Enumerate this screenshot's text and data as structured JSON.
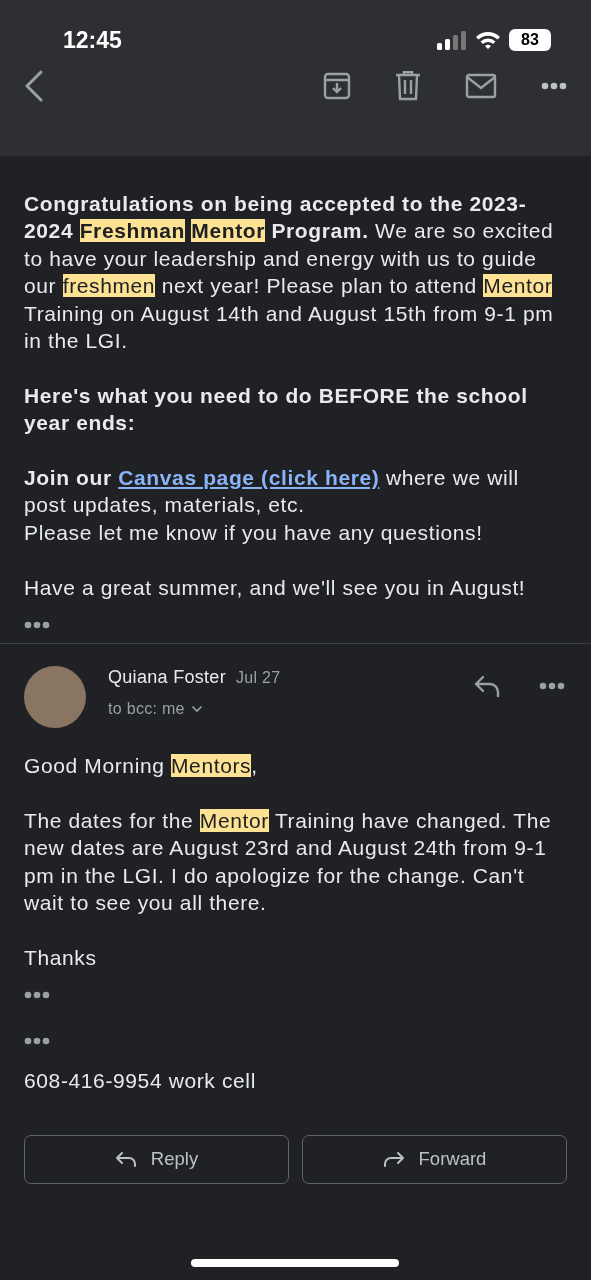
{
  "status_bar": {
    "time": "12:45",
    "battery": "83"
  },
  "messages": [
    {
      "blocks": [
        {
          "kind": "paragraph",
          "segments": [
            {
              "text": "Congratulations on being accepted to the 2023-2024 ",
              "bold": true,
              "highlighted": false
            },
            {
              "text": "Freshman",
              "bold": true,
              "highlighted": true
            },
            {
              "text": "Mentor",
              "bold": true,
              "highlighted": true
            },
            {
              "text": " Program.",
              "bold": true,
              "highlighted": false
            },
            {
              "text": " We are so excited to have your leadership and energy with us to guide our ",
              "bold": false,
              "highlighted": false
            },
            {
              "text": "freshmen",
              "bold": false,
              "highlighted": true
            },
            {
              "text": " next year! Please plan to attend ",
              "bold": false,
              "highlighted": false
            },
            {
              "text": "Mentor",
              "bold": false,
              "highlighted": true
            },
            {
              "text": " Training on August 14th and August 15th from 9-1 pm in the LGI.",
              "bold": false,
              "highlighted": false
            }
          ]
        },
        {
          "kind": "paragraph",
          "segments": [
            {
              "text": "Here's what you need to do BEFORE the school year ends:",
              "bold": true,
              "highlighted": false
            }
          ]
        },
        {
          "kind": "line",
          "segments": [
            {
              "text": "Join our ",
              "bold": true,
              "highlighted": false
            },
            {
              "text": "Canvas page (click here)",
              "bold": true,
              "highlighted": false,
              "link": true
            },
            {
              "text": " where we will post updates, materials, etc.",
              "bold": false,
              "highlighted": false
            }
          ]
        },
        {
          "kind": "paragraph",
          "segments": [
            {
              "text": "Please let me know if you have any questions!",
              "bold": false,
              "highlighted": false
            }
          ]
        },
        {
          "kind": "line",
          "segments": [
            {
              "text": "Have a great summer, and we'll see you in August!",
              "bold": false,
              "highlighted": false
            }
          ]
        },
        {
          "kind": "ellipsis"
        }
      ]
    },
    {
      "sender": "Quiana Foster",
      "date": "Jul 27",
      "recipients": "to bcc: me",
      "blocks": [
        {
          "kind": "paragraph",
          "segments": [
            {
              "text": "Good Morning ",
              "bold": false,
              "highlighted": false
            },
            {
              "text": "Mentors",
              "bold": false,
              "highlighted": true
            },
            {
              "text": ",",
              "bold": false,
              "highlighted": false
            }
          ]
        },
        {
          "kind": "paragraph",
          "segments": [
            {
              "text": "The dates for the ",
              "bold": false,
              "highlighted": false
            },
            {
              "text": "Mentor",
              "bold": false,
              "highlighted": true
            },
            {
              "text": " Training have changed. The new dates are August 23rd and August 24th from 9-1 pm in the LGI. I do apologize for the change. Can't wait to see you all there.",
              "bold": false,
              "highlighted": false
            }
          ]
        },
        {
          "kind": "line",
          "segments": [
            {
              "text": "Thanks",
              "bold": false,
              "highlighted": false
            }
          ]
        },
        {
          "kind": "ellipsis"
        },
        {
          "kind": "ellipsis"
        },
        {
          "kind": "line",
          "segments": [
            {
              "text": "608-416-9954 work cell",
              "bold": false,
              "highlighted": false
            }
          ]
        }
      ]
    }
  ],
  "actions": [
    {
      "label": "Reply",
      "kind": "reply"
    },
    {
      "label": "Forward",
      "kind": "forward"
    }
  ]
}
